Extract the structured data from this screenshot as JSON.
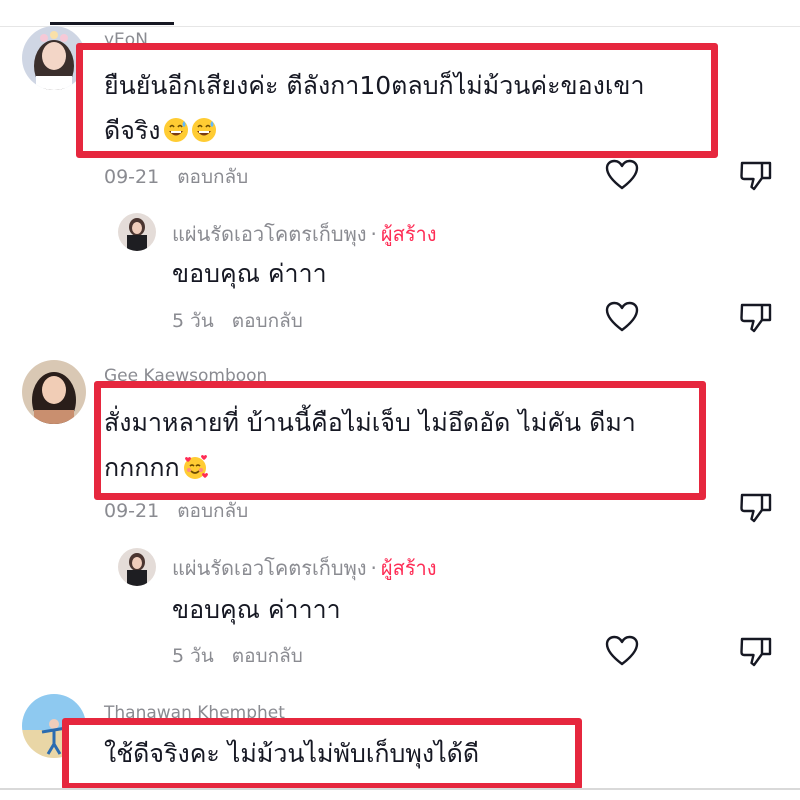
{
  "comments": [
    {
      "username": "yEoN",
      "line1": "ยืนยันอีกเสียงค่ะ ตีลังกา10ตลบก็ไม่ม้วนค่ะของเขา",
      "line2": "ดีจริง",
      "emoji": [
        "grinning-sweat-emoji",
        "grinning-sweat-emoji"
      ],
      "date": "09-21",
      "reply_label": "ตอบกลับ",
      "reply": {
        "username": "แผ่นรัดเอวโคตรเก็บพุง",
        "separator": "·",
        "creator_label": "ผู้สร้าง",
        "text": "ขอบคุณ ค่าาา",
        "date": "5 วัน",
        "reply_label": "ตอบกลับ"
      }
    },
    {
      "username": "Gee Kaewsomboon",
      "line1": "สั่งมาหลายที่ บ้านนี้คือไม่เจ็บ ไม่อึดอัด ไม่คัน ดีมา",
      "line2": "กกกกก",
      "emoji": [
        "smiling-face-with-hearts-emoji"
      ],
      "date": "09-21",
      "reply_label": "ตอบกลับ",
      "reply": {
        "username": "แผ่นรัดเอวโคตรเก็บพุง",
        "separator": "·",
        "creator_label": "ผู้สร้าง",
        "text": "ขอบคุณ ค่าาาา",
        "date": "5 วัน",
        "reply_label": "ตอบกลับ"
      }
    },
    {
      "username": "Thanawan Khemphet",
      "line1": "ใช้ดีจริงคะ ไม่ม้วนไม่พับเก็บพุงได้ดี"
    }
  ],
  "colors": {
    "highlight": "#e6273e",
    "creator": "#fe2c55",
    "meta": "#8a8b91",
    "text": "#161823"
  },
  "icons": {
    "like": "heart-outline-icon",
    "dislike": "thumbs-down-outline-icon"
  }
}
